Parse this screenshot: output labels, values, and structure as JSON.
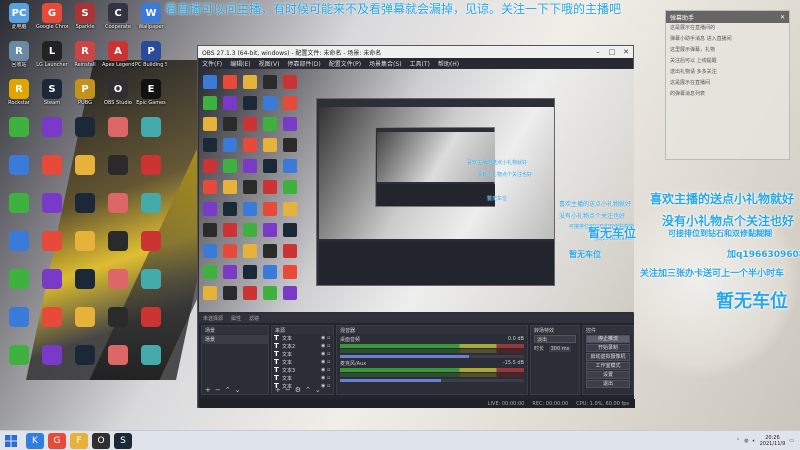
{
  "banner_text": "看直播可以问主播，有时候可能来不及看弹幕就会漏掉，见谅。关注一下下哦的主播吧",
  "desktop_icons": [
    {
      "label": "此电脑",
      "color": "#5aa0e0",
      "glyph": "PC"
    },
    {
      "label": "Google Chrome",
      "color": "#e84a3a",
      "glyph": "G"
    },
    {
      "label": "Sparkle",
      "color": "#a33",
      "glyph": "S"
    },
    {
      "label": "Cooperate",
      "color": "#334",
      "glyph": "C"
    },
    {
      "label": "Wallpaper",
      "color": "#3a7ad8",
      "glyph": "W"
    },
    {
      "label": "回收站",
      "color": "#6a8aa6",
      "glyph": "R"
    },
    {
      "label": "LG Launcher",
      "color": "#222",
      "glyph": "L"
    },
    {
      "label": "Reinstall",
      "color": "#c44",
      "glyph": "R"
    },
    {
      "label": "Apex Legends",
      "color": "#c33",
      "glyph": "A"
    },
    {
      "label": "PC Building Simulator",
      "color": "#2a4a9a",
      "glyph": "P"
    },
    {
      "label": "Rockstar",
      "color": "#e1a500",
      "glyph": "R"
    },
    {
      "label": "Steam",
      "color": "#1b2838",
      "glyph": "S"
    },
    {
      "label": "PUBG",
      "color": "#c2921a",
      "glyph": "P"
    },
    {
      "label": "OBS Studio",
      "color": "#302e31",
      "glyph": "O"
    },
    {
      "label": "Epic Games",
      "color": "#111",
      "glyph": "E"
    }
  ],
  "obs": {
    "title": "OBS 27.1.3 (64-bit, windows) - 配置文件: 未命名 - 场景: 未命名",
    "menu": [
      "文件(F)",
      "编辑(E)",
      "视图(V)",
      "停靠部件(D)",
      "配置文件(P)",
      "场景集合(S)",
      "工具(T)",
      "帮助(H)"
    ],
    "dock_header_labels": [
      "未选择源",
      "属性",
      "滤镜"
    ],
    "docks": {
      "scenes_title": "场景",
      "scenes": [
        "场景"
      ],
      "sources_title": "来源",
      "sources": [
        {
          "name": "文本"
        },
        {
          "name": "文本2"
        },
        {
          "name": "文本"
        },
        {
          "name": "文本"
        },
        {
          "name": "文本3"
        },
        {
          "name": "文本"
        },
        {
          "name": "文本"
        }
      ],
      "mixer_title": "混音器",
      "mixer": [
        {
          "name": "桌面音频",
          "db": "0.0 dB",
          "level": 0.7
        },
        {
          "name": "麦克风/Aux",
          "db": "-15.5 dB",
          "level": 0.55
        }
      ],
      "trans_title": "转场特效",
      "trans_type": "淡出",
      "trans_duration_label": "时长",
      "trans_duration": "300 ms",
      "ctrl_title": "控件",
      "controls": [
        "停止推流",
        "开始录制",
        "启动虚拟摄像机",
        "工作室模式",
        "设置",
        "退出"
      ]
    },
    "status": [
      "LIVE: 00:00:00",
      "REC: 00:00:00",
      "CPU: 1.0%, 60.00 fps"
    ]
  },
  "chat": {
    "header": "弹幕助手",
    "messages": [
      "这是展示在直播间的",
      "弹幕小助手消息 进入直播间",
      "这里展示弹幕，礼物",
      "关注后可以 上线提醒",
      "送出礼物请 多多关注",
      "这是展示在直播间",
      "的弹幕消息列表"
    ]
  },
  "overlay": {
    "line1": "喜欢主播的送点小礼物就好",
    "line2": "没有小礼物点个关注也好",
    "line3": "可接排位到钻石和双修黏糊糊",
    "line4": "加q1966309608",
    "line5": "关注加三张办卡送可上一个半小时车",
    "line6": "暂无车位"
  },
  "taskbar": {
    "apps": [
      {
        "name": "kook",
        "color": "#2f7ee0",
        "glyph": "K"
      },
      {
        "name": "chrome",
        "color": "#e84a3a",
        "glyph": "G"
      },
      {
        "name": "folder",
        "color": "#e7b23a",
        "glyph": "F"
      },
      {
        "name": "obs",
        "color": "#302e31",
        "glyph": "O"
      },
      {
        "name": "steam",
        "color": "#1b2838",
        "glyph": "S"
      }
    ],
    "time": "20:26",
    "date": "2021/11/9"
  }
}
